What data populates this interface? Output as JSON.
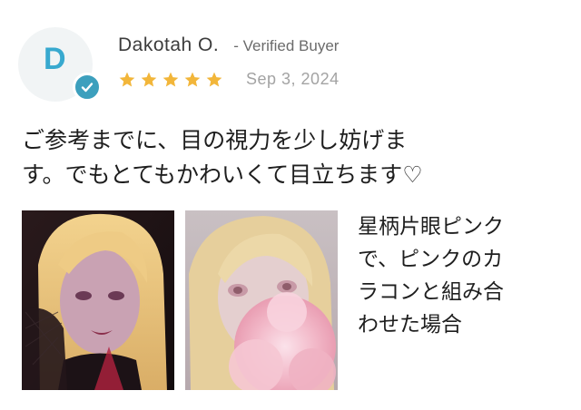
{
  "reviewer": {
    "initial": "D",
    "name": "Dakotah O.",
    "verified_label": "- Verified Buyer",
    "rating": 5,
    "rating_max": 5,
    "date": "Sep 3, 2024"
  },
  "review": {
    "lines": [
      "ご参考までに、目の視力を少し妨げま",
      "す。でもとてもかわいくて目立ちます♡"
    ]
  },
  "caption": {
    "lines": [
      "星柄片眼ピンク",
      "で、ピンクのカ",
      "ラコンと組み合",
      "わせた場合"
    ]
  },
  "colors": {
    "accent": "#3c9fbd",
    "star": "#f2b63a",
    "avatar_letter": "#38a9cf"
  }
}
